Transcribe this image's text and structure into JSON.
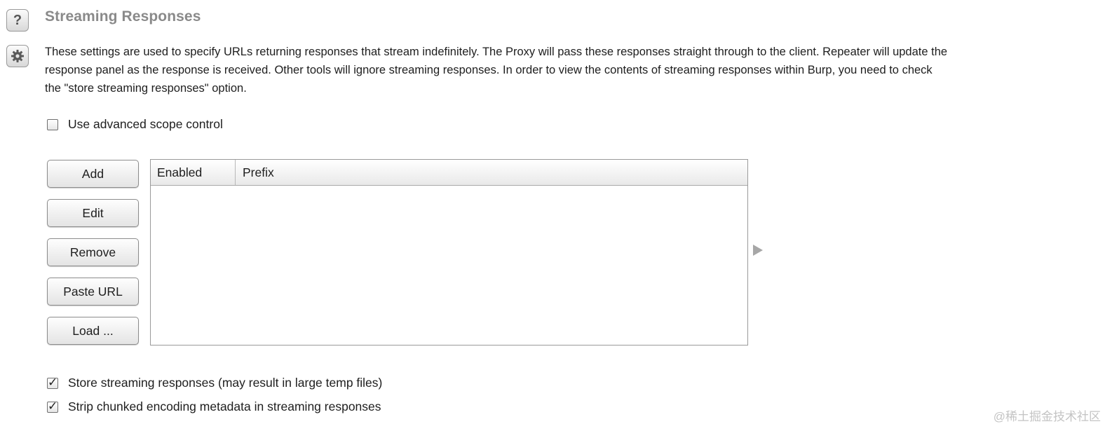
{
  "section": {
    "title": "Streaming Responses",
    "help_icon": "?",
    "description_lines": [
      "These settings are used to specify URLs returning responses that stream indefinitely. The Proxy will pass these responses straight through to the client. Repeater will update the",
      "response panel as the response is received. Other tools will ignore streaming responses. In order to view the contents of streaming responses within Burp, you need to check",
      "the \"store streaming responses\" option."
    ]
  },
  "scope": {
    "advanced_label": "Use advanced scope control",
    "advanced_checked": false
  },
  "buttons": {
    "add": "Add",
    "edit": "Edit",
    "remove": "Remove",
    "paste_url": "Paste URL",
    "load": "Load ..."
  },
  "table": {
    "columns": [
      "Enabled",
      "Prefix"
    ],
    "rows": []
  },
  "options": {
    "store_label": "Store streaming responses (may result in large temp files)",
    "store_checked": true,
    "strip_label": "Strip chunked encoding metadata in streaming responses",
    "strip_checked": true
  },
  "watermark": "@稀土掘金技术社区",
  "icons": {
    "help": "help-icon",
    "settings": "gear-icon",
    "expand": "expand-arrow-icon",
    "checkmark": "checkmark-icon"
  }
}
